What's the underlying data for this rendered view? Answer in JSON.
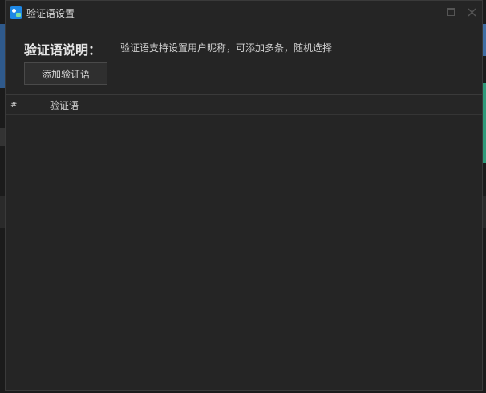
{
  "window": {
    "title": "验证语设置",
    "controls": [
      "minimize",
      "maximize",
      "close"
    ]
  },
  "content": {
    "heading": "验证语说明：",
    "description": "验证语支持设置用户昵称，可添加多条，随机选择",
    "add_button_label": "添加验证语"
  },
  "table": {
    "columns": [
      "#",
      "验证语"
    ],
    "rows": []
  },
  "colors": {
    "background": "#252525",
    "text": "#d8d8d8",
    "app_icon": "#1e88e5"
  }
}
